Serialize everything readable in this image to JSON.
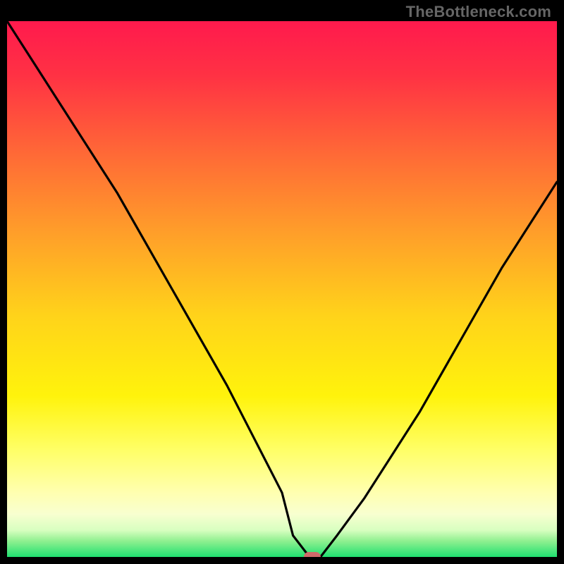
{
  "watermark": "TheBottleneck.com",
  "chart_data": {
    "type": "line",
    "title": "",
    "xlabel": "",
    "ylabel": "",
    "xlim": [
      0,
      100
    ],
    "ylim": [
      0,
      100
    ],
    "series": [
      {
        "name": "curve",
        "x": [
          0,
          5,
          10,
          15,
          20,
          25,
          30,
          35,
          40,
          45,
          50,
          52,
          55,
          56,
          57,
          60,
          65,
          70,
          75,
          80,
          85,
          90,
          95,
          100
        ],
        "values": [
          100,
          92,
          84,
          76,
          68,
          59,
          50,
          41,
          32,
          22,
          12,
          4,
          0,
          0,
          0,
          4,
          11,
          19,
          27,
          36,
          45,
          54,
          62,
          70
        ]
      }
    ],
    "marker": {
      "x": 55.5,
      "y": 0,
      "color": "#d06a6a",
      "rx": 12,
      "ry": 7
    },
    "gradient_stops": [
      {
        "offset": 0.0,
        "color": "#ff1a4d"
      },
      {
        "offset": 0.1,
        "color": "#ff3144"
      },
      {
        "offset": 0.25,
        "color": "#ff6a36"
      },
      {
        "offset": 0.4,
        "color": "#ffa029"
      },
      {
        "offset": 0.55,
        "color": "#ffd31a"
      },
      {
        "offset": 0.7,
        "color": "#fff30c"
      },
      {
        "offset": 0.8,
        "color": "#ffff66"
      },
      {
        "offset": 0.88,
        "color": "#ffffb0"
      },
      {
        "offset": 0.92,
        "color": "#f8ffd0"
      },
      {
        "offset": 0.95,
        "color": "#d8ffc0"
      },
      {
        "offset": 0.97,
        "color": "#90f090"
      },
      {
        "offset": 1.0,
        "color": "#20e070"
      }
    ],
    "plot_bg_border": "#000000"
  }
}
